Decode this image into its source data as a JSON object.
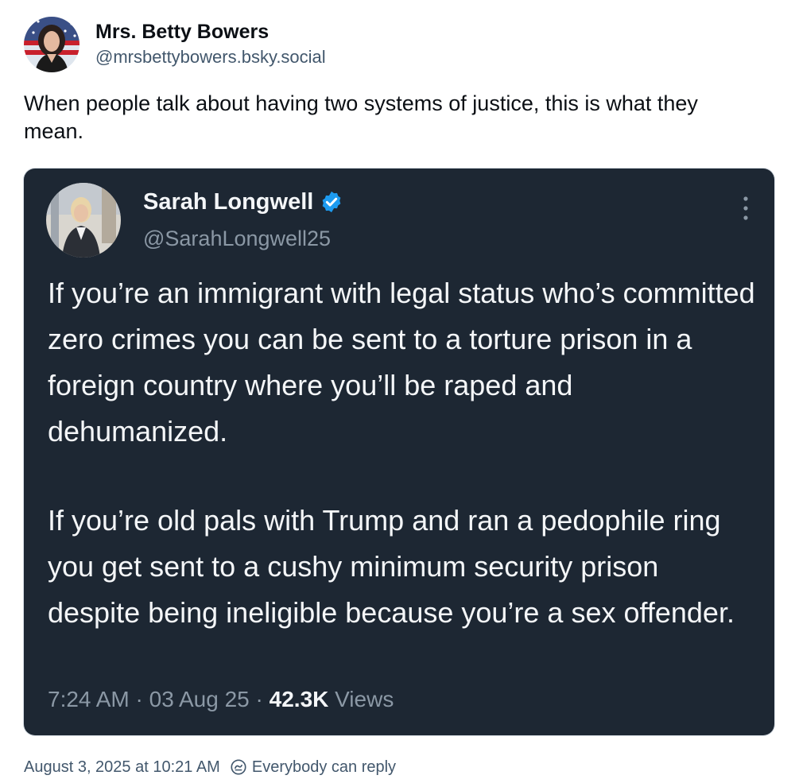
{
  "author": {
    "display_name": "Mrs. Betty Bowers",
    "handle": "@mrsbettybowers.bsky.social",
    "avatar_icon": "profile-photo"
  },
  "post": {
    "text": "When people talk about having two systems of justice, this is what they mean."
  },
  "quoted_tweet": {
    "display_name": "Sarah Longwell",
    "handle": "@SarahLongwell25",
    "verified": true,
    "verified_color": "#1d9bf0",
    "paragraphs": [
      "If you’re an immigrant with legal status who’s committed zero crimes you can be sent to a torture prison in a foreign country where you’ll be raped and dehumanized.",
      "If you’re old pals with Trump and ran a pedophile ring you get sent to a cushy minimum security prison despite being ineligible because you’re a sex offender."
    ],
    "time": "7:24 AM",
    "separator": "·",
    "date": "03 Aug 25",
    "views_count": "42.3K",
    "views_label": "Views",
    "background_color": "#1d2733"
  },
  "footer": {
    "timestamp": "August 3, 2025 at 10:21 AM",
    "reply_setting": "Everybody can reply",
    "reply_icon": "reply-restriction-icon"
  }
}
